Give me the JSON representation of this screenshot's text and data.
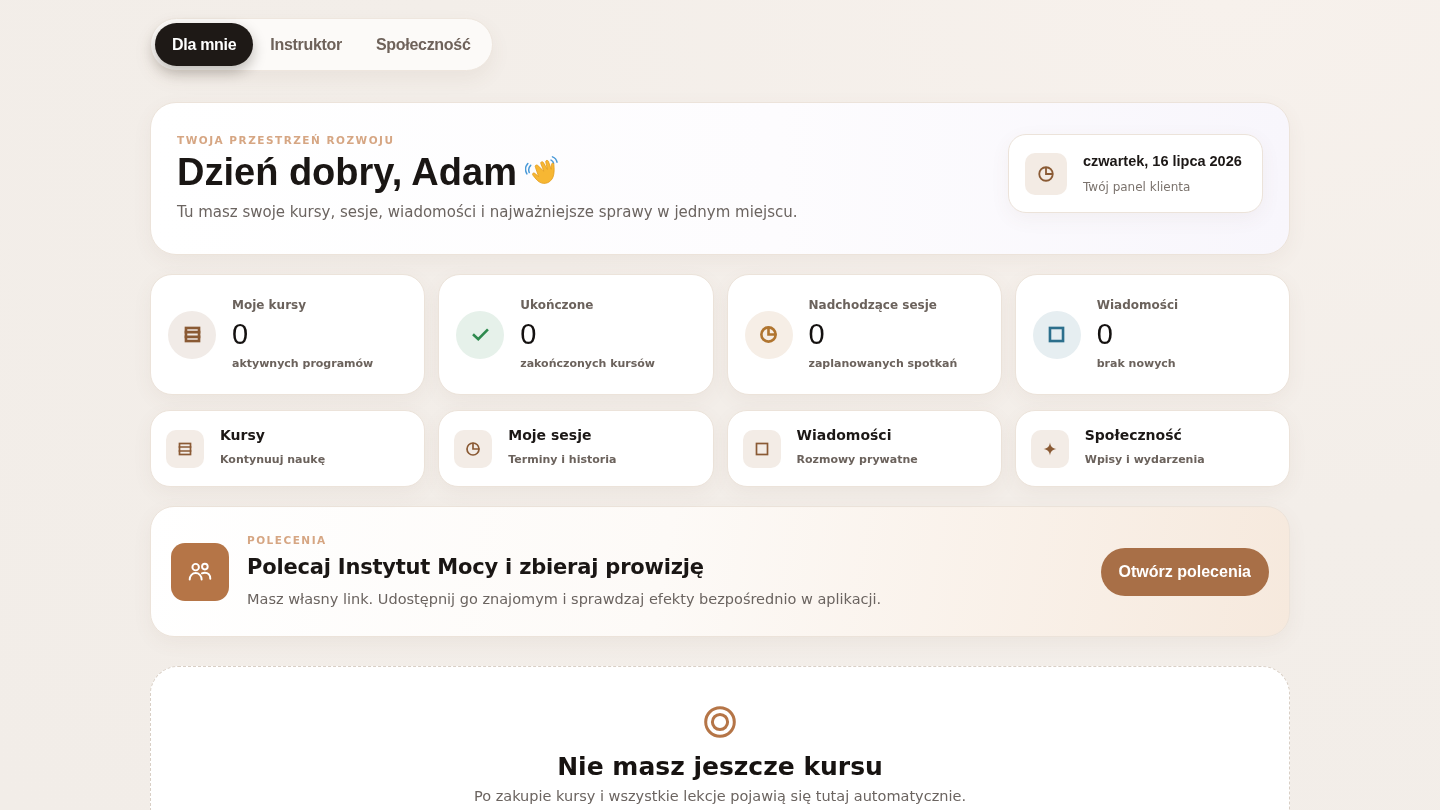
{
  "tabs": [
    {
      "label": "Dla mnie",
      "selected": true
    },
    {
      "label": "Instruktor",
      "selected": false
    },
    {
      "label": "Społeczność",
      "selected": false
    }
  ],
  "hero": {
    "eyebrow": "TWOJA PRZESTRZEŃ ROZWOJU",
    "title": "Dzień dobry, Adam",
    "subtitle": "Tu masz swoje kursy, sesje, wiadomości i najważniejsze sprawy w jednym miejscu.",
    "date_card": {
      "date": "czwartek, 16 lipca 2026",
      "caption": "Twój panel klienta"
    }
  },
  "stats": [
    {
      "kind": "courses",
      "label": "Moje kursy",
      "value": "0",
      "caption": "aktywnych programów",
      "color": "#8a5a34"
    },
    {
      "kind": "completed",
      "label": "Ukończone",
      "value": "0",
      "caption": "zakończonych kursów",
      "color": "#2e8a4e"
    },
    {
      "kind": "sessions",
      "label": "Nadchodzące sesje",
      "value": "0",
      "caption": "zaplanowanych spotkań",
      "color": "#b07530"
    },
    {
      "kind": "messages",
      "label": "Wiadomości",
      "value": "0",
      "caption": "brak nowych",
      "color": "#2c6f8c"
    }
  ],
  "quick_links": [
    {
      "kind": "courses",
      "title": "Kursy",
      "subtitle": "Kontynuuj naukę"
    },
    {
      "kind": "sessions",
      "title": "Moje sesje",
      "subtitle": "Terminy i historia"
    },
    {
      "kind": "messages",
      "title": "Wiadomości",
      "subtitle": "Rozmowy prywatne"
    },
    {
      "kind": "community",
      "title": "Społeczność",
      "subtitle": "Wpisy i wydarzenia"
    }
  ],
  "referral": {
    "eyebrow": "POLECENIA",
    "title": "Polecaj Instytut Mocy i zbieraj prowizję",
    "text": "Masz własny link. Udostępnij go znajomym i sprawdzaj efekty bezpośrednio w aplikacji.",
    "button": "Otwórz polecenia"
  },
  "empty_state": {
    "title": "Nie masz jeszcze kursu",
    "text": "Po zakupie kursy i wszystkie lekcje pojawią się tutaj automatycznie."
  }
}
